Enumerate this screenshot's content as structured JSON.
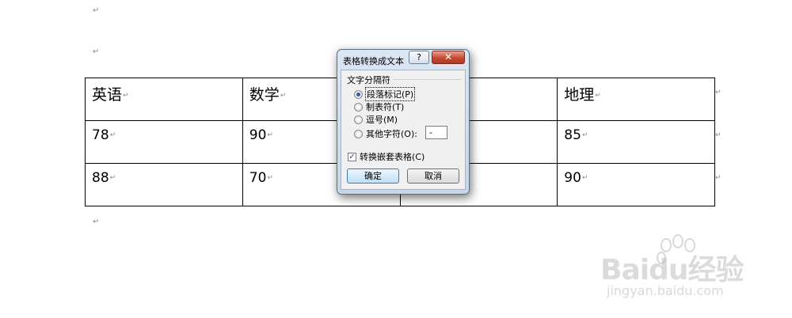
{
  "document": {
    "para_mark": "↵",
    "cell_mark": "↵",
    "table": {
      "headers": [
        "英语",
        "数学",
        "",
        "地理"
      ],
      "rows": [
        [
          "78",
          "90",
          "",
          "85"
        ],
        [
          "88",
          "70",
          "",
          "90"
        ]
      ]
    }
  },
  "dialog": {
    "title": "表格转换成文本",
    "help_label": "?",
    "close_label": "✕",
    "group_label": "文字分隔符",
    "options": [
      {
        "label": "段落标记(P)",
        "selected": true
      },
      {
        "label": "制表符(T)",
        "selected": false
      },
      {
        "label": "逗号(M)",
        "selected": false
      },
      {
        "label": "其他字符(O):",
        "selected": false
      }
    ],
    "other_char_value": "-",
    "convert_nested_label": "转换嵌套表格(C)",
    "convert_nested_checked": true,
    "check_mark": "✓",
    "ok_label": "确定",
    "cancel_label": "取消"
  },
  "watermark": {
    "brand": "Baidu经验",
    "url": "jingyan.baidu.com"
  }
}
